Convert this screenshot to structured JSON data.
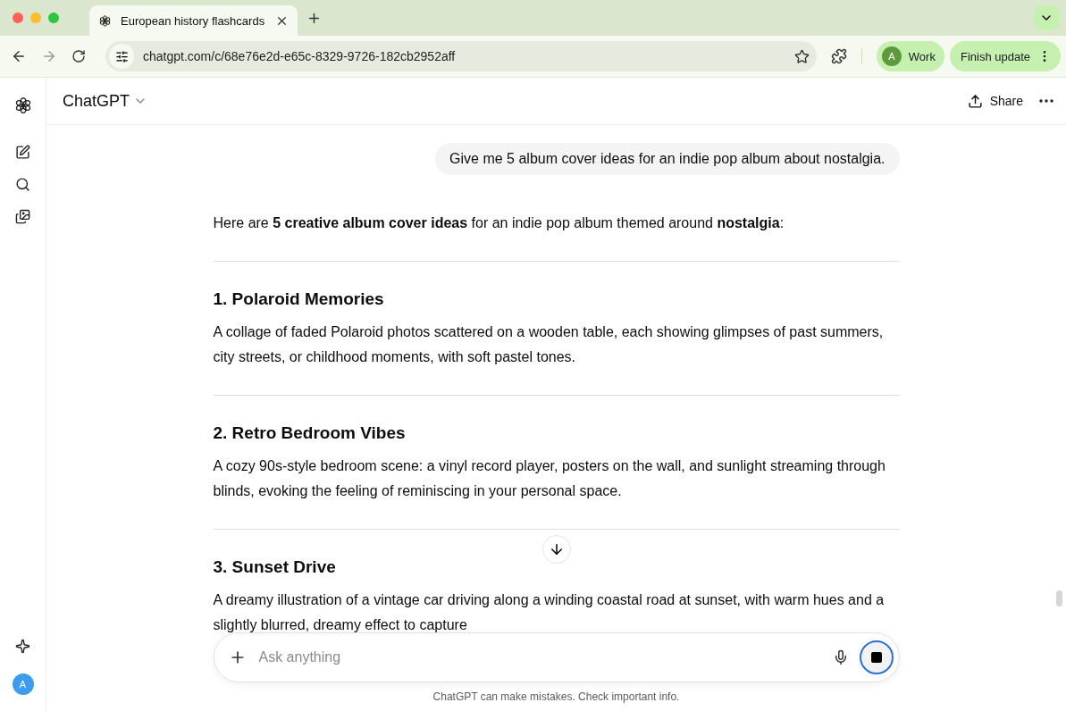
{
  "browser": {
    "tab_title": "European history flashcards",
    "url": "chatgpt.com/c/68e76e2d-e65c-8329-9726-182cb2952aff",
    "profile": {
      "initial": "A",
      "label": "Work"
    },
    "update_button": "Finish update"
  },
  "sidebar": {
    "avatar": "A"
  },
  "header": {
    "title": "ChatGPT",
    "share": "Share"
  },
  "chat": {
    "user_message": "Give me 5 album cover ideas for an indie pop album about nostalgia.",
    "intro": "Here are **5 creative album cover ideas** for an indie pop album themed around **nostalgia**:",
    "sections": [
      {
        "heading": "1. Polaroid Memories",
        "body": "A collage of faded Polaroid photos scattered on a wooden table, each showing glimpses of past summers, city streets, or childhood moments, with soft pastel tones."
      },
      {
        "heading": "2. Retro Bedroom Vibes",
        "body": "A cozy 90s-style bedroom scene: a vinyl record player, posters on the wall, and sunlight streaming through blinds, evoking the feeling of reminiscing in your personal space."
      },
      {
        "heading": "3. Sunset Drive",
        "body": "A dreamy illustration of a vintage car driving along a winding coastal road at sunset, with warm hues and a slightly blurred, dreamy effect to capture"
      }
    ]
  },
  "composer": {
    "placeholder": "Ask anything",
    "generating": true
  },
  "disclaimer": "ChatGPT can make mistakes. Check important info."
}
